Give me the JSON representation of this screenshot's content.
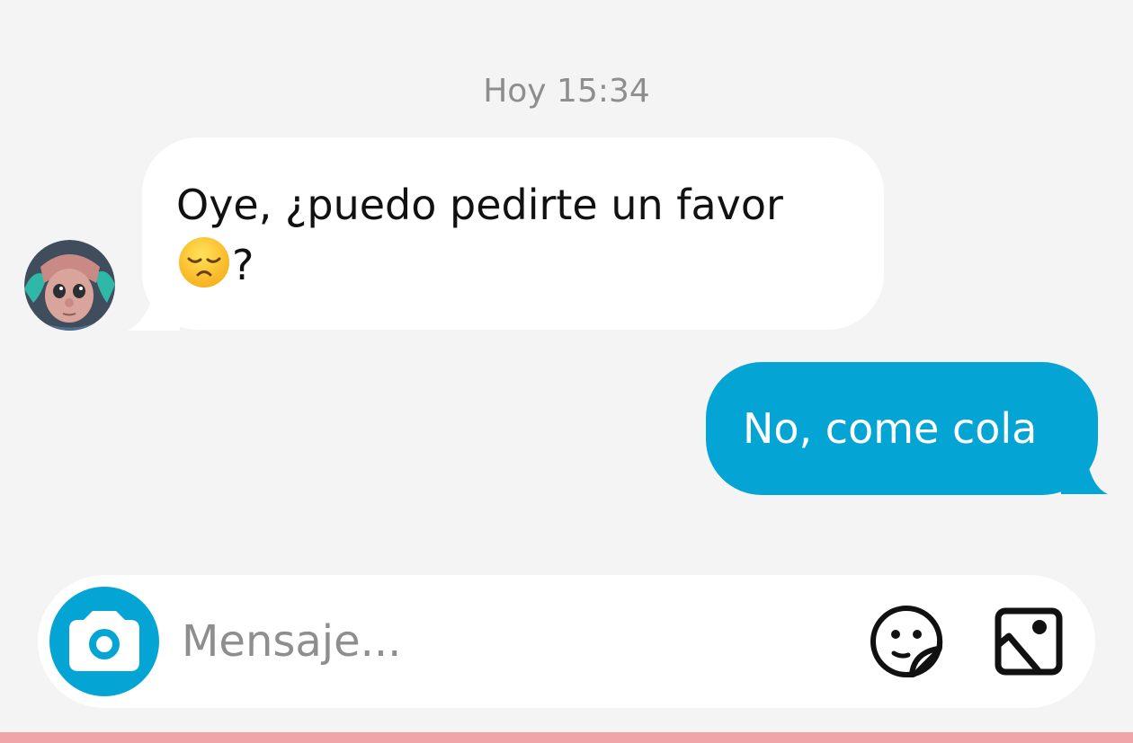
{
  "conversation": {
    "timestamp": "Hoy 15:34",
    "messages": [
      {
        "direction": "incoming",
        "text_line1": "Oye, ¿puedo pedirte un favor",
        "emoji": "disappointed-face",
        "text_after_emoji": "?"
      },
      {
        "direction": "outgoing",
        "text": "No, come cola"
      }
    ]
  },
  "composer": {
    "placeholder": "Mensaje...",
    "value": ""
  },
  "icons": {
    "camera": "camera-icon",
    "sticker": "sticker-icon",
    "gallery": "image-icon"
  },
  "colors": {
    "background": "#f4f4f4",
    "incoming_bubble": "#ffffff",
    "outgoing_bubble": "#04a5d4",
    "accent": "#04a5d4",
    "timestamp_text": "#8e8e8e",
    "bottom_bar": "#f0a6a9"
  }
}
